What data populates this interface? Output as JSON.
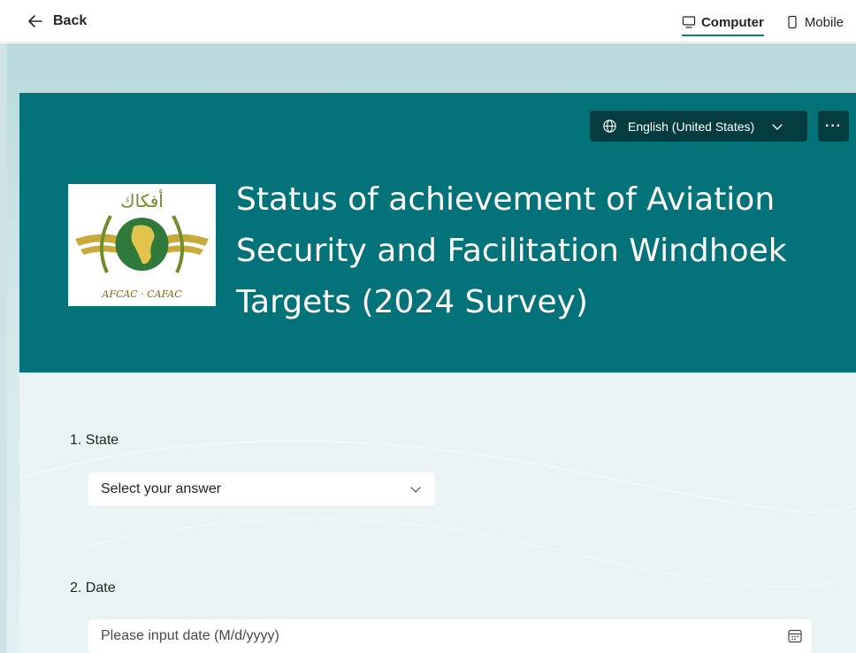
{
  "topbar": {
    "back_label": "Back",
    "view_options": [
      {
        "label": "Computer",
        "icon": "monitor-icon",
        "active": true
      },
      {
        "label": "Mobile",
        "icon": "phone-icon",
        "active": false
      }
    ]
  },
  "header": {
    "language": "English (United States)",
    "more_label": "···",
    "title": "Status of achievement of Aviation Security and Facilitation Windhoek Targets (2024 Survey)",
    "logo_text": "AFCAC · CAFAC",
    "logo_arabic": "أفكاك"
  },
  "questions": [
    {
      "number": "1.",
      "label": "State",
      "placeholder": "Select your answer"
    },
    {
      "number": "2.",
      "label": "Date",
      "placeholder": "Please input date (M/d/yyyy)"
    }
  ],
  "colors": {
    "brand": "#037279",
    "accent": "#0f7b80",
    "button_dark": "#053c40",
    "page_bg": "#d3e8ea"
  }
}
